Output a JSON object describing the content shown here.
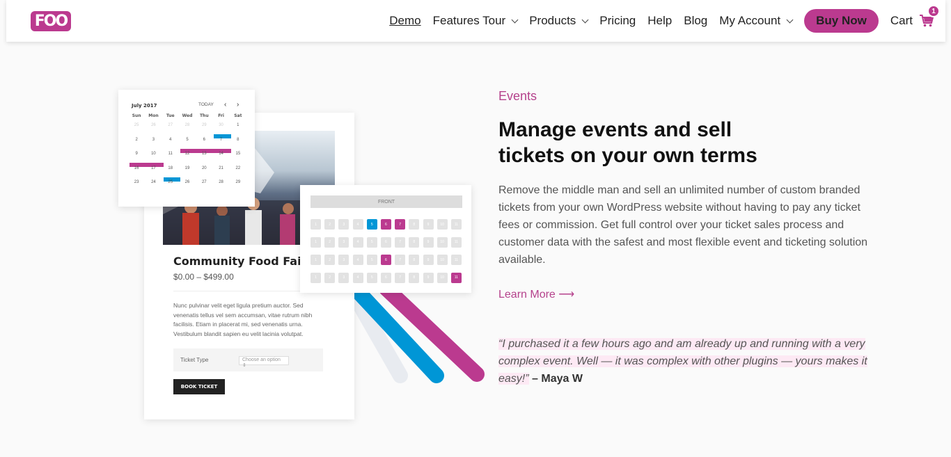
{
  "header": {
    "logo": "FOO",
    "nav": [
      {
        "label": "Demo",
        "active": true,
        "dropdown": false
      },
      {
        "label": "Features Tour",
        "active": false,
        "dropdown": true
      },
      {
        "label": "Products",
        "active": false,
        "dropdown": true
      },
      {
        "label": "Pricing",
        "active": false,
        "dropdown": false
      },
      {
        "label": "Help",
        "active": false,
        "dropdown": false
      },
      {
        "label": "Blog",
        "active": false,
        "dropdown": false
      },
      {
        "label": "My Account",
        "active": false,
        "dropdown": true
      }
    ],
    "buy_now": "Buy Now",
    "cart_label": "Cart",
    "cart_count": "1"
  },
  "illustration": {
    "calendar": {
      "month": "July 2017",
      "today": "TODAY",
      "prev": "‹",
      "next": "›",
      "days": [
        "Sun",
        "Mon",
        "Tue",
        "Wed",
        "Thu",
        "Fri",
        "Sat"
      ],
      "rows": [
        [
          "25",
          "26",
          "27",
          "28",
          "29",
          "30",
          "1"
        ],
        [
          "2",
          "3",
          "4",
          "5",
          "6",
          "7",
          "8"
        ],
        [
          "9",
          "10",
          "11",
          "12",
          "13",
          "14",
          "15"
        ],
        [
          "16",
          "17",
          "18",
          "19",
          "20",
          "21",
          "22"
        ],
        [
          "23",
          "24",
          "25",
          "26",
          "27",
          "28",
          "29"
        ]
      ]
    },
    "event_card": {
      "title": "Community Food Fair",
      "price": "$0.00 – $499.00",
      "description": "Nunc pulvinar velit eget ligula pretium auctor. Sed venenatis tellus vel sem accumsan, vitae rutrum nibh facilisis. Etiam in placerat mi, sed venenatis urna. Vestibulum blandit sapien eu velit lacinia volutpat.",
      "ticket_type_label": "Ticket Type",
      "ticket_select": "Choose an option ⇕",
      "book_button": "BOOK TICKET"
    },
    "seat_map": {
      "front_label": "FRONT",
      "rows": [
        [
          {
            "n": "1"
          },
          {
            "n": "2"
          },
          {
            "n": "3"
          },
          {
            "n": "4"
          },
          {
            "n": "5",
            "s": "blue"
          },
          {
            "n": "6",
            "s": "pink"
          },
          {
            "n": "7",
            "s": "pink"
          },
          {
            "n": "8"
          },
          {
            "n": "9"
          },
          {
            "n": "10"
          },
          {
            "n": "11"
          }
        ],
        [
          {
            "n": "1"
          },
          {
            "n": "2"
          },
          {
            "n": "3"
          },
          {
            "n": "4"
          },
          {
            "n": "5"
          },
          {
            "n": "6"
          },
          {
            "n": "7"
          },
          {
            "n": "8"
          },
          {
            "n": "9"
          },
          {
            "n": "10"
          },
          {
            "n": "11"
          }
        ],
        [
          {
            "n": "1"
          },
          {
            "n": "2"
          },
          {
            "n": "3"
          },
          {
            "n": "4"
          },
          {
            "n": "5"
          },
          {
            "n": "6",
            "s": "pink"
          },
          {
            "n": "7"
          },
          {
            "n": "8"
          },
          {
            "n": "9"
          },
          {
            "n": "10"
          },
          {
            "n": "11"
          }
        ],
        [
          {
            "n": "1"
          },
          {
            "n": "2"
          },
          {
            "n": "3"
          },
          {
            "n": "4"
          },
          {
            "n": "5"
          },
          {
            "n": "6"
          },
          {
            "n": "7"
          },
          {
            "n": "8"
          },
          {
            "n": "9"
          },
          {
            "n": "10"
          },
          {
            "n": "11",
            "s": "pink"
          }
        ]
      ]
    }
  },
  "content": {
    "eyebrow": "Events",
    "headline_line1": "Manage events and sell",
    "headline_line2": "tickets on your own terms",
    "body": "Remove the middle man and sell an unlimited number of custom branded tickets from your own WordPress website without having to pay any ticket fees or commission. Get full control over your ticket sales process and customer data with the safest and most flexible event and ticketing solution available.",
    "learn_more": "Learn More ⟶",
    "quote": "“I purchased it a few hours ago and am already up and running with a very complex event. Well — it was complex with other plugins — yours makes it easy!”",
    "quote_author": " – Maya W"
  },
  "colors": {
    "brand": "#bb3a8f",
    "blue": "#0096d6",
    "quote_highlight": "#fde9f4"
  }
}
